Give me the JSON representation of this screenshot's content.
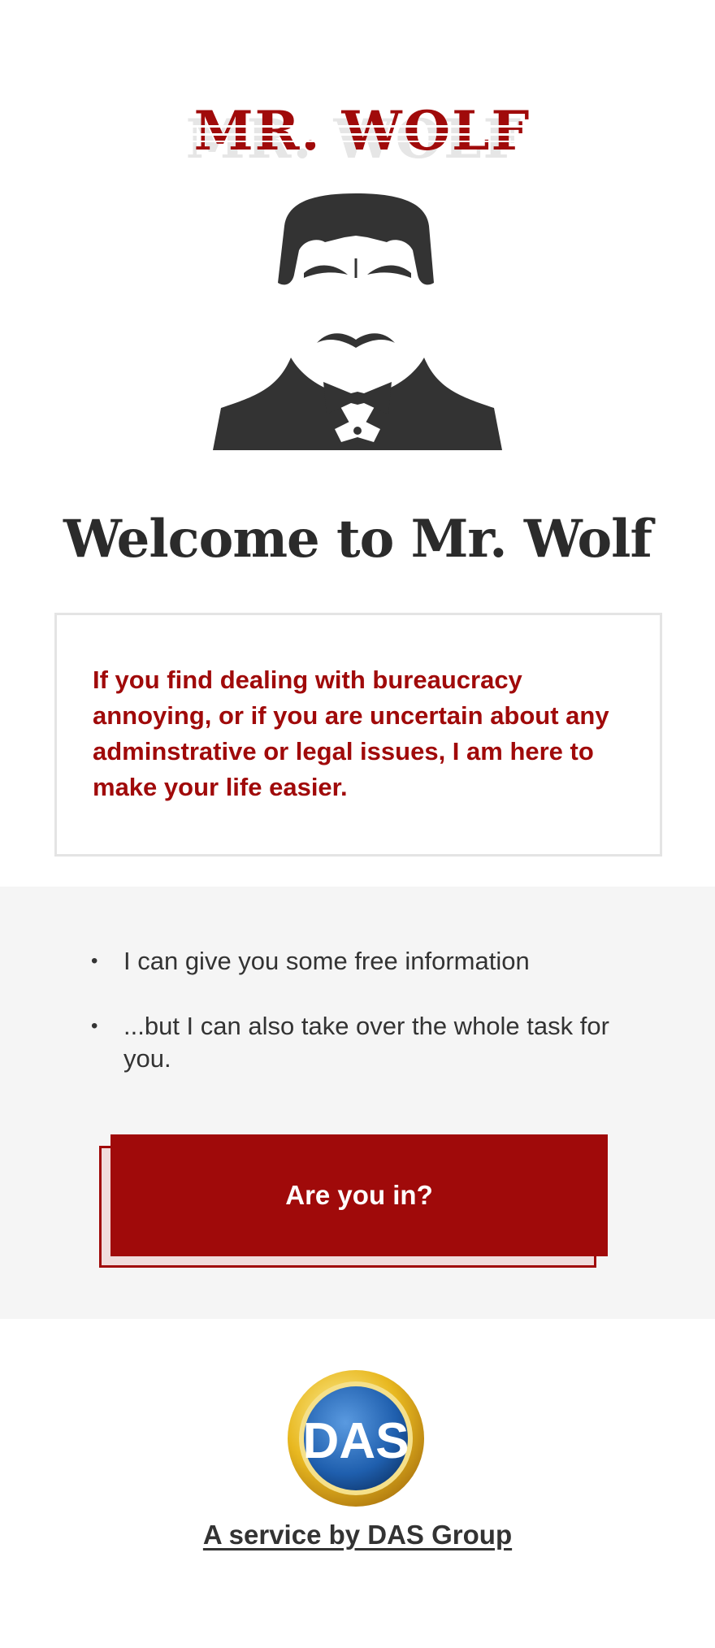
{
  "header": {
    "logo_text": "MR. WOLF",
    "logo_icon": "mr-wolf-wordmark"
  },
  "mascot": {
    "icon": "mr-wolf-character-icon"
  },
  "main": {
    "title": "Welcome to Mr. Wolf",
    "intro": "If you find dealing with bureaucracy annoying, or if you are uncertain about any adminstrative or legal issues, I am here to make your life easier."
  },
  "features": {
    "items": [
      {
        "text": "I can give you some free information"
      },
      {
        "text": "...but I can also take over the whole task for you."
      }
    ],
    "bullet_glyph": "•"
  },
  "cta": {
    "label": "Are you in?"
  },
  "footer": {
    "logo_text": "DAS",
    "service_text": "A service by DAS Group"
  },
  "colors": {
    "brand_red": "#a00a0a",
    "text_dark": "#333333",
    "section_grey": "#f5f5f5",
    "das_blue": "#1f5fae",
    "das_gold": "#e8b820"
  }
}
